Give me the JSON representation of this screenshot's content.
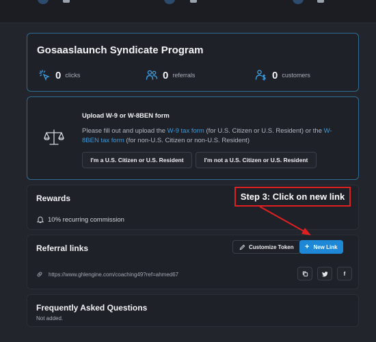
{
  "program": {
    "title": "Gosaaslaunch Syndicate Program",
    "stats": [
      {
        "value": "0",
        "label": "clicks",
        "icon": "cursor-click-icon"
      },
      {
        "value": "0",
        "label": "referrals",
        "icon": "users-icon"
      },
      {
        "value": "0",
        "label": "customers",
        "icon": "customer-dollar-icon"
      }
    ]
  },
  "tax": {
    "title": "Upload W-9 or W-8BEN form",
    "desc_part1": "Please fill out and upload the ",
    "w9_link": "W-9 tax form",
    "desc_part2": " (for U.S. Citizen or U.S. Resident) or the ",
    "w8_link": "W-8BEN tax form",
    "desc_part3": " (for non-U.S. Citizen or non-U.S. Resident)",
    "btn_us": "I'm a U.S. Citizen or U.S. Resident",
    "btn_non_us": "I'm not a U.S. Citizen or U.S. Resident"
  },
  "rewards": {
    "title": "Rewards",
    "commission": "10% recurring commission"
  },
  "referral": {
    "title": "Referral links",
    "customize_label": "Customize Token",
    "new_link_label": "New Link",
    "url": "https://www.ghlengine.com/coaching49?ref=ahmed67",
    "twitter_label": "",
    "facebook_label": "f"
  },
  "faq": {
    "title": "Frequently Asked Questions",
    "empty": "Not added."
  },
  "annotation": {
    "text": "Step 3: Click on new link"
  },
  "colors": {
    "accent": "#1e88d6",
    "card_border_highlight": "#2f6c92",
    "annotation": "#e02020"
  }
}
